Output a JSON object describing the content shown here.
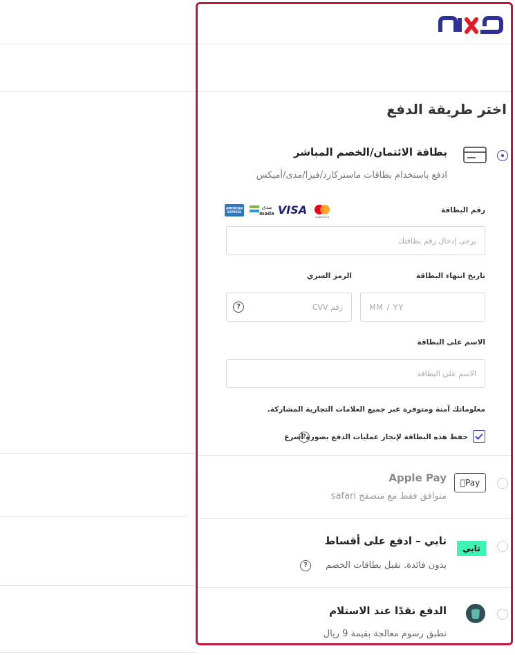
{
  "brand": {
    "logo_alt": "ماكس",
    "colors": {
      "primary": "#2e3192",
      "accent": "#e41b23",
      "frame": "#c0183a",
      "radio": "#3b46c6",
      "tabby": "#3ef3b3"
    }
  },
  "checkout": {
    "title": "اختر طريقة الدفع",
    "card_option": {
      "title": "بطاقة الائتمان/الخصم المباشر",
      "description": "ادفع باستخدام بطاقات ماستركارد/فيزا/مدى/أميكس",
      "icon": "credit-card-icon",
      "card_number": {
        "label": "رقم البطاقة",
        "placeholder": "يرجى إدخال رقم بطاقتك"
      },
      "expiry": {
        "label": "تاريخ انتهاء البطاقة",
        "placeholder": "MM / YY"
      },
      "cvv": {
        "label": "الرمز السري",
        "placeholder": "رقم CVV",
        "help": "?"
      },
      "name": {
        "label": "الاسم على البطاقة",
        "placeholder": "الاسم على البطاقة"
      },
      "secure_note": "معلوماتك آمنة ومتوفرة عبر جميع العلامات التجارية المشاركة.",
      "save_card": {
        "label": "حفظ هذه البطاقة لإنجاز عمليات الدفع بصورة أسرع",
        "checked": true,
        "help": "?"
      },
      "networks": [
        "mastercard",
        "VISA",
        "mada",
        "amex"
      ],
      "network_labels": {
        "visa": "VISA",
        "mada_ar": "مدى",
        "mada_en": "mada",
        "amex": "AMERICAN EXPRESS",
        "mastercard": "mastercard"
      }
    },
    "apple_pay": {
      "title": "Apple Pay",
      "description": "متوافق فقط مع متصفح safari",
      "badge": "Pay"
    },
    "tabby": {
      "title": "تابي – ادفع على أقساط",
      "description": "بدون فائدة. نقبل بطاقات الخصم",
      "badge": "تابي",
      "help": "?"
    },
    "cod": {
      "title": "الدفع نقدًا عند الاستلام",
      "description": "تطبق رسوم معالجة بقيمة 9 ريال"
    }
  }
}
